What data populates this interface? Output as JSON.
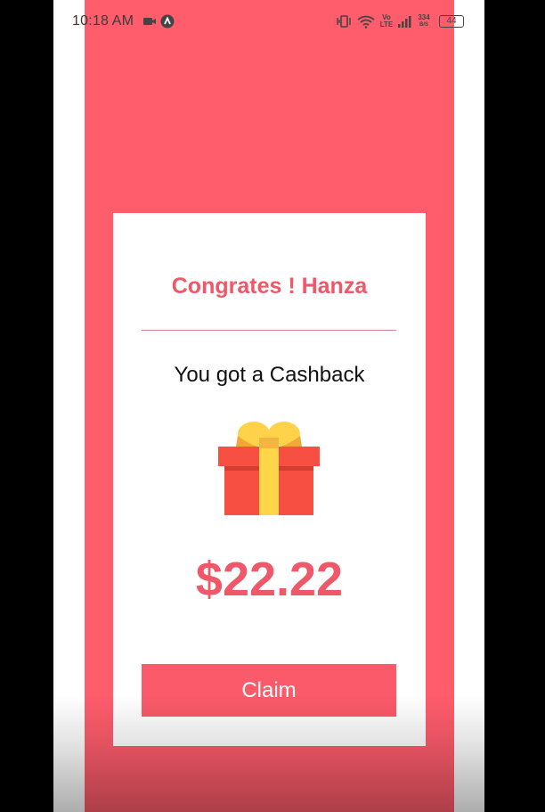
{
  "status_bar": {
    "time": "10:18 AM",
    "network_speed": "334",
    "network_unit": "B/S",
    "volte_top": "Vo",
    "volte_bottom": "LTE",
    "battery": "44"
  },
  "card": {
    "title": "Congrates ! Hanza",
    "subtitle": "You got a Cashback",
    "amount": "$22.22",
    "claim_label": "Claim"
  },
  "colors": {
    "accent": "#ff5c6c",
    "title": "#ef5868",
    "button": "#fa5a69",
    "gift_box": "#f74f41",
    "gift_ribbon": "#ffd64a"
  },
  "icons": [
    "video-record-icon",
    "app-notification-icon",
    "vibrate-icon",
    "wifi-icon",
    "signal-icon",
    "battery-icon",
    "gift-icon"
  ]
}
